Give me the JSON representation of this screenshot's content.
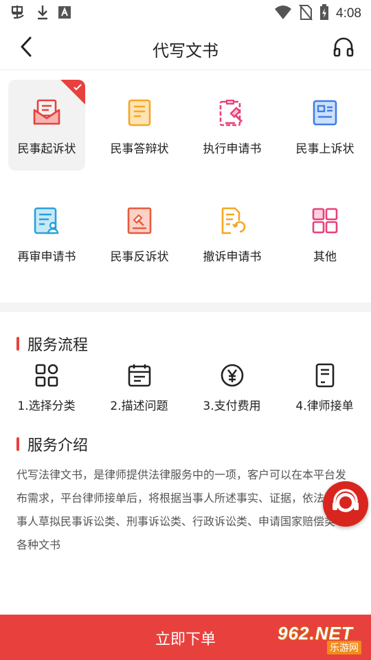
{
  "status_bar": {
    "time": "4:08",
    "left_icons": [
      "notification-app-icon",
      "download-icon",
      "text-a-icon"
    ],
    "right_icons": [
      "wifi-icon",
      "no-sim-icon",
      "battery-charging-icon"
    ]
  },
  "header": {
    "title": "代写文书",
    "back_icon": "chevron-left-icon",
    "support_icon": "headphones-icon"
  },
  "categories": [
    {
      "label": "民事起诉状",
      "icon": "envelope-doc-icon",
      "color": "#e8413d",
      "selected": true
    },
    {
      "label": "民事答辩状",
      "icon": "doc-lines-icon",
      "color": "#f5a623"
    },
    {
      "label": "执行申请书",
      "icon": "clipboard-gavel-icon",
      "color": "#e8417a"
    },
    {
      "label": "民事上诉状",
      "icon": "id-card-icon",
      "color": "#3d7ee8"
    },
    {
      "label": "再审申请书",
      "icon": "doc-person-icon",
      "color": "#2aa0d8"
    },
    {
      "label": "民事反诉状",
      "icon": "gavel-doc-icon",
      "color": "#e85a3d"
    },
    {
      "label": "撤诉申请书",
      "icon": "doc-undo-icon",
      "color": "#f5a623"
    },
    {
      "label": "其他",
      "icon": "grid-squares-icon",
      "color": "#e8417a"
    }
  ],
  "process": {
    "title": "服务流程",
    "steps": [
      {
        "label": "1.选择分类",
        "icon": "categories-icon"
      },
      {
        "label": "2.描述问题",
        "icon": "calendar-note-icon"
      },
      {
        "label": "3.支付费用",
        "icon": "yuan-coin-icon"
      },
      {
        "label": "4.律师接单",
        "icon": "document-icon"
      }
    ]
  },
  "intro": {
    "title": "服务介绍",
    "text": "代写法律文书，是律师提供法律服务中的一项，客户可以在本平台发布需求，平台律师接单后，将根据当事人所述事实、证据，依法为当事人草拟民事诉讼类、刑事诉讼类、行政诉讼类、申请国家赔偿类等各种文书"
  },
  "floating_service_icon": "customer-service-icon",
  "bottom": {
    "order_label": "立即下单",
    "watermark_num": "962.NET",
    "watermark_sub": "乐游网"
  },
  "colors": {
    "accent": "#e8413d",
    "text": "#222222",
    "muted_text": "#555555",
    "band": "#f4f4f4"
  }
}
